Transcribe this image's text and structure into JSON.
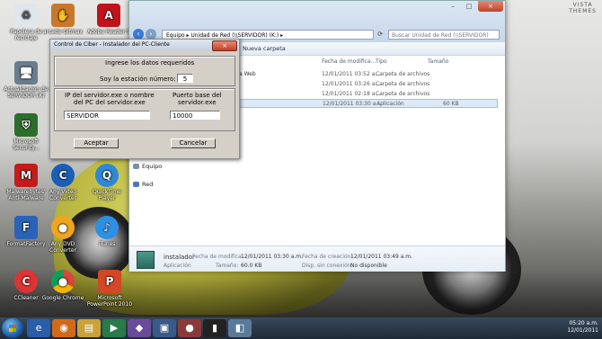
{
  "desktop": {
    "theme_mark": [
      "VISTA",
      "THEMES"
    ],
    "icons": [
      {
        "label": "Papelera de reciclaje"
      },
      {
        "label": "arcade Gitmax"
      },
      {
        "label": "Adobe Reader 9"
      },
      {
        "label": "P"
      },
      {
        "label": "Actualizacion de SERVIDOR (K)"
      },
      {
        "label": "Microsoft Security..."
      },
      {
        "label": "Malwarebytes' Anti-Malware"
      },
      {
        "label": "Any Video Converter"
      },
      {
        "label": "QuickTime Player"
      },
      {
        "label": "FormatFactory"
      },
      {
        "label": "Any DVD Converter"
      },
      {
        "label": "iTunes"
      },
      {
        "label": "CCleaner"
      },
      {
        "label": "Google Chrome"
      },
      {
        "label": "Microsoft PowerPoint 2010"
      }
    ]
  },
  "explorer": {
    "address": "Equipo ▸ Unidad de Red (\\\\SERVIDOR) (K:) ▸",
    "search_placeholder": "Buscar Unidad de Red (\\\\SERVIDOR) (K:)",
    "toolbar": {
      "new_folder": "Nueva carpeta"
    },
    "columns": {
      "modified": "Fecha de modifica...",
      "type": "Tipo",
      "size": "Tamaño"
    },
    "files": [
      {
        "name": "mera Web",
        "date": "12/01/2011 03:52 a...",
        "type": "Carpeta de archivos",
        "size": ""
      },
      {
        "name": "",
        "date": "12/01/2011 03:26 a...",
        "type": "Carpeta de archivos",
        "size": ""
      },
      {
        "name": "",
        "date": "12/01/2011 02:18 a...",
        "type": "Carpeta de archivos",
        "size": ""
      },
      {
        "name": "",
        "date": "12/01/2011 03:30 a...",
        "type": "Aplicación",
        "size": "60 KB"
      }
    ],
    "nav": {
      "equipo": "Equipo",
      "red": "Red"
    },
    "details": {
      "name": "instalador",
      "type": "Aplicación",
      "modified_label": "Fecha de modifica...",
      "modified_value": "12/01/2011 03:30 a.m.",
      "size_label": "Tamaño:",
      "size_value": "60.0 KB",
      "created_label": "Fecha de creación:",
      "created_value": "12/01/2011 03:49 a.m.",
      "offline_label": "Disp. sin conexión:",
      "offline_value": "No disponible"
    }
  },
  "dialog": {
    "title": "Control de Ciber - Instalador del PC-Cliente",
    "close": "×",
    "header": "Ingrese los datos requeridos",
    "station_label": "Soy la estación número:",
    "station_value": "5",
    "server_label_line1": "IP del servidor.exe o nombre",
    "server_label_line2": "del PC del servidor.exe",
    "server_value": "SERVIDOR",
    "port_label_line1": "Puerto base del",
    "port_label_line2": "servidor.exe",
    "port_value": "10000",
    "ok": "Aceptar",
    "cancel": "Cancelar"
  },
  "taskbar": {
    "time": "05:20 a.m.",
    "date": "12/01/2011",
    "items": [
      "ie-icon",
      "firefox-icon",
      "explorer-icon",
      "media-player-icon",
      "app-icon",
      "app-icon",
      "app-icon",
      "cmd-icon",
      "app-icon"
    ]
  }
}
